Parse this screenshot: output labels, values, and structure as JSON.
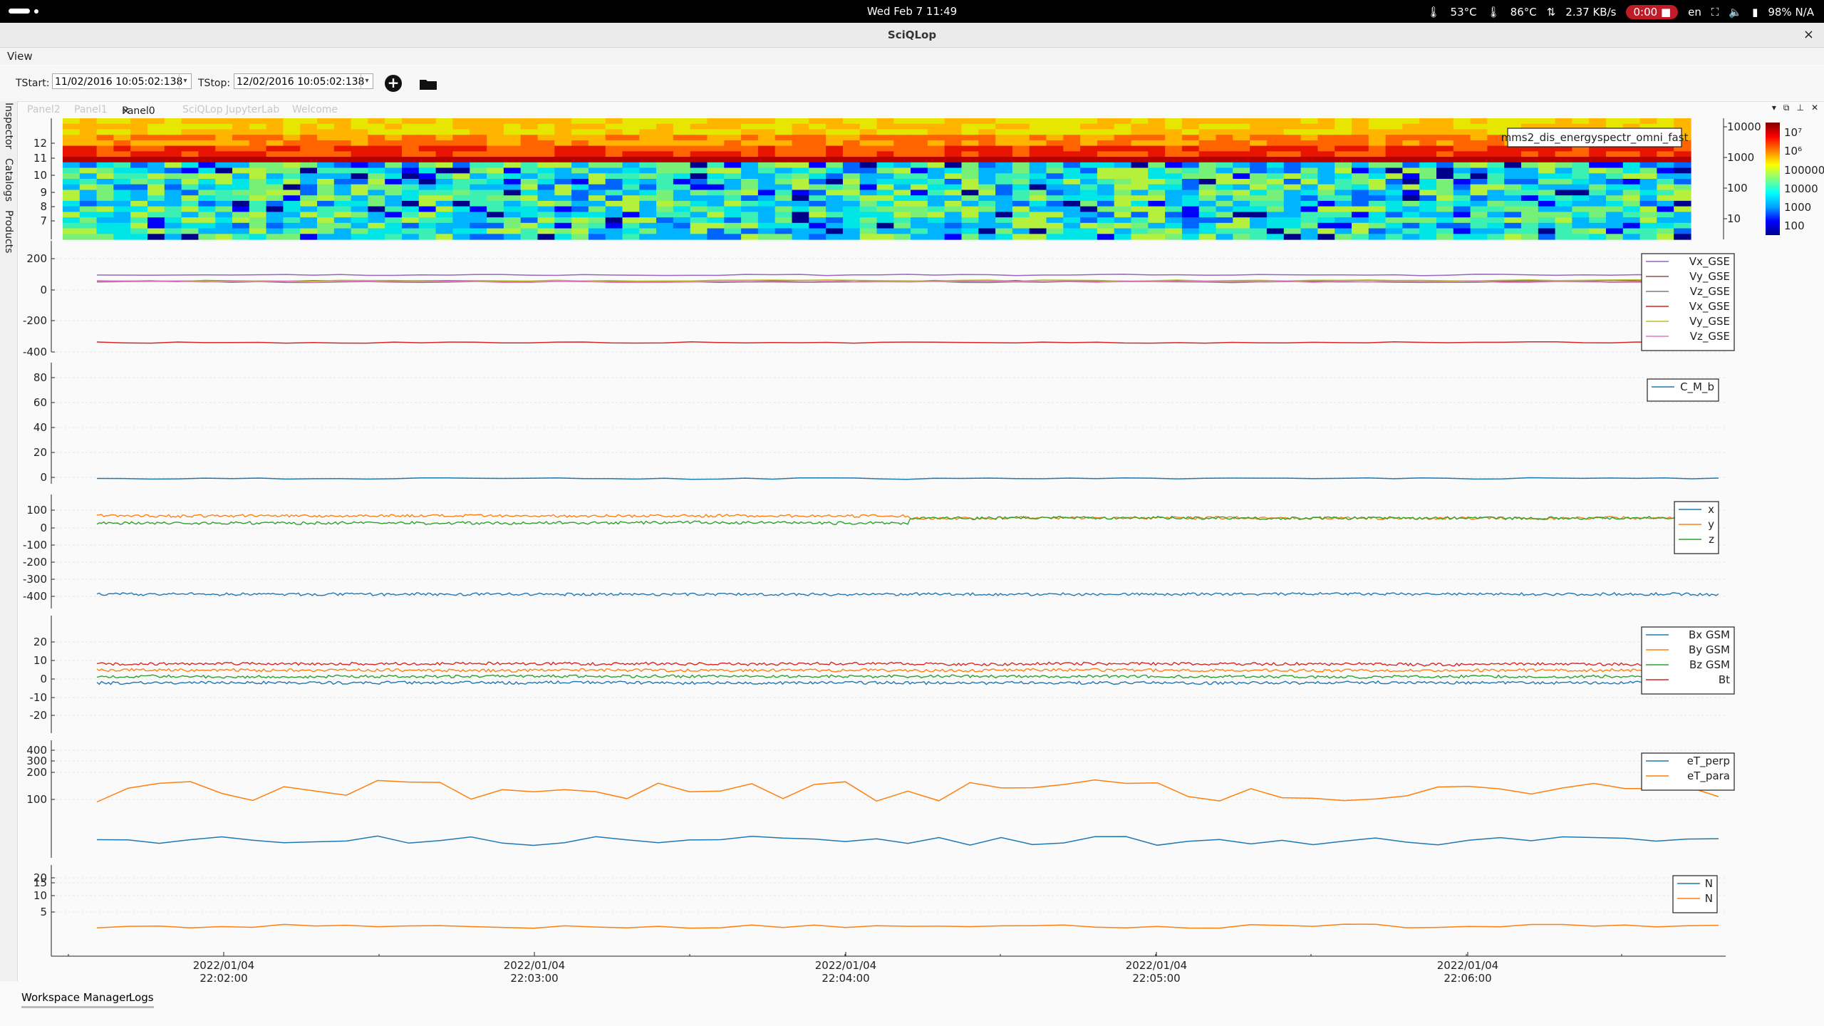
{
  "system": {
    "clock": "Wed Feb 7  11:49",
    "cpu_temp": "53°C",
    "gpu_temp": "86°C",
    "net_speed": "2.37 KB/s",
    "record_time": "0:00",
    "keyboard_layout": "en",
    "battery": "98% N/A"
  },
  "window": {
    "title": "SciQLop",
    "close_glyph": "×"
  },
  "menu": {
    "view": "View"
  },
  "toolbar": {
    "tstart_label": "TStart:",
    "tstart_value": "11/02/2016 10:05:02:138",
    "tstop_label": "TStop:",
    "tstop_value": "12/02/2016 10:05:02:138"
  },
  "side_tabs": [
    "Inspector",
    "Catalogs",
    "Products"
  ],
  "tabs": [
    {
      "label": "Panel2",
      "active": false
    },
    {
      "label": "Panel1",
      "active": false
    },
    {
      "label": "Panel0",
      "active": true,
      "close": "×"
    },
    {
      "label": "SciQLop JupyterLab",
      "active": false
    },
    {
      "label": "Welcome",
      "active": false
    }
  ],
  "bottom_tabs": [
    "Workspace Manager",
    "Logs"
  ],
  "colors": {
    "blue": "#1f77b4",
    "orange": "#ff7f0e",
    "green": "#2ca02c",
    "red": "#d62728",
    "purple": "#9467bd",
    "brown": "#8c564b",
    "record": "#c01c28"
  },
  "chart_data": [
    {
      "type": "heatmap",
      "y_ticks": [
        "7",
        "8",
        "9",
        "10",
        "11",
        "12"
      ],
      "right_axis_ticks": [
        "10000",
        "1000",
        "100",
        "10"
      ],
      "colorbar_ticks": [
        "10⁷",
        "10⁶",
        "100000",
        "10000",
        "1000",
        "100"
      ],
      "legend": [
        "mms2_dis_energyspectr_omni_fast"
      ]
    },
    {
      "type": "line",
      "y_ticks": [
        "200",
        "0",
        "-200",
        "-400"
      ],
      "ylim": [
        -420,
        230
      ],
      "series": [
        {
          "name": "Vx_GSE",
          "color": "#9467bd",
          "base": 30
        },
        {
          "name": "Vy_GSE",
          "color": "#8c564b",
          "base": -5
        },
        {
          "name": "Vz_GSE",
          "color": "#7f7f7f",
          "base": -10
        },
        {
          "name": "Vx_GSE",
          "color": "#d62728",
          "base": -365
        },
        {
          "name": "Vy_GSE",
          "color": "#bcbd22",
          "base": -2
        },
        {
          "name": "Vz_GSE",
          "color": "#e377c2",
          "base": -8
        }
      ]
    },
    {
      "type": "line",
      "y_ticks": [
        "80",
        "60",
        "40",
        "20",
        "0"
      ],
      "ylim": [
        -5,
        85
      ],
      "series": [
        {
          "name": "C_M_b",
          "color": "#1f77b4",
          "base": -1
        }
      ]
    },
    {
      "type": "line",
      "y_ticks": [
        "100",
        "0",
        "-100",
        "-200",
        "-300",
        "-400"
      ],
      "ylim": [
        -440,
        120
      ],
      "series": [
        {
          "name": "x",
          "color": "#1f77b4",
          "base": -370
        },
        {
          "name": "y",
          "color": "#ff7f0e",
          "base": 15
        },
        {
          "name": "z",
          "color": "#2ca02c",
          "base": -20
        }
      ]
    },
    {
      "type": "line",
      "y_ticks": [
        "20",
        "10",
        "0",
        "-10",
        "-20"
      ],
      "ylim": [
        -28,
        28
      ],
      "series": [
        {
          "name": "Bx GSM",
          "color": "#1f77b4",
          "base": -4
        },
        {
          "name": "By GSM",
          "color": "#ff7f0e",
          "base": 2
        },
        {
          "name": "Bz GSM",
          "color": "#2ca02c",
          "base": -1
        },
        {
          "name": "Bt",
          "color": "#d62728",
          "base": 5
        }
      ]
    },
    {
      "type": "line",
      "log_scale": true,
      "y_ticks": [
        "400",
        "300",
        "200",
        "100"
      ],
      "ylim": [
        30,
        420
      ],
      "series": [
        {
          "name": "eT_perp",
          "color": "#1f77b4",
          "base": 55
        },
        {
          "name": "eT_para",
          "color": "#ff7f0e",
          "base": 240
        }
      ]
    },
    {
      "type": "line",
      "log_scale": true,
      "y_ticks": [
        "20",
        "15",
        "10",
        "5"
      ],
      "ylim": [
        1.5,
        22
      ],
      "series": [
        {
          "name": "N",
          "color": "#1f77b4",
          "base": 3.2
        },
        {
          "name": "N",
          "color": "#ff7f0e",
          "base": 3.2
        }
      ]
    }
  ],
  "x_axis": {
    "ticks": [
      {
        "date": "2022/01/04",
        "time": "22:02:00"
      },
      {
        "date": "2022/01/04",
        "time": "22:03:00"
      },
      {
        "date": "2022/01/04",
        "time": "22:04:00"
      },
      {
        "date": "2022/01/04",
        "time": "22:05:00"
      },
      {
        "date": "2022/01/04",
        "time": "22:06:00"
      }
    ]
  }
}
